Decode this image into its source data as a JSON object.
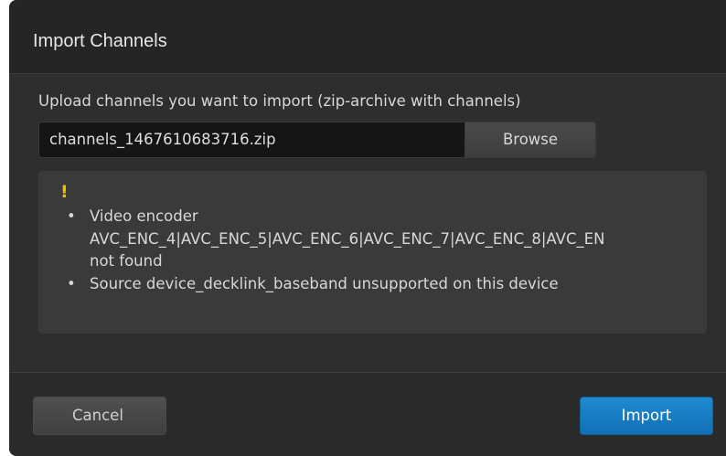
{
  "dialog": {
    "title": "Import Channels"
  },
  "upload": {
    "label": "Upload channels you want to import (zip-archive with channels)",
    "file_value": "channels_1467610683716.zip",
    "browse_label": "Browse"
  },
  "warning": {
    "icon": "exclamation-icon",
    "icon_text": "!",
    "icon_color": "#f0c000",
    "bullet": "•",
    "items": [
      {
        "lines": [
          "Video encoder",
          "AVC_ENC_4|AVC_ENC_5|AVC_ENC_6|AVC_ENC_7|AVC_ENC_8|AVC_EN",
          "not found"
        ]
      },
      {
        "lines": [
          "Source device_decklink_baseband unsupported on this device"
        ]
      }
    ]
  },
  "footer": {
    "cancel_label": "Cancel",
    "import_label": "Import",
    "import_color": "#1a7fc4"
  }
}
